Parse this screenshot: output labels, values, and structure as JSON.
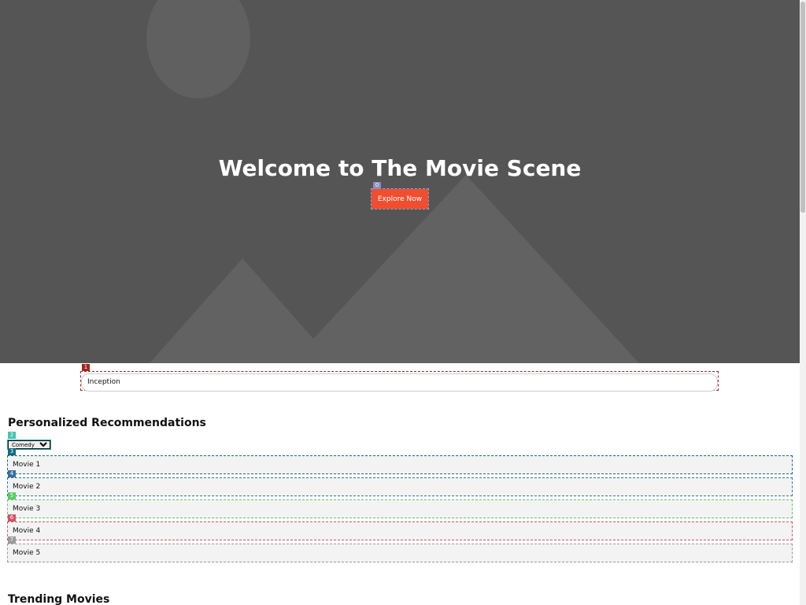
{
  "hero": {
    "title": "Welcome to The Movie Scene",
    "button_label": "Explore Now"
  },
  "search": {
    "value": "Inception"
  },
  "recommendations": {
    "title": "Personalized Recommendations",
    "selected_genre": "Comedy",
    "movies": [
      "Movie 1",
      "Movie 2",
      "Movie 3",
      "Movie 4",
      "Movie 5"
    ]
  },
  "trending": {
    "title": "Trending Movies"
  },
  "markers": [
    "0",
    "1",
    "2",
    "3",
    "4",
    "5",
    "6",
    "7"
  ],
  "colors": {
    "hero_bg": "#555555",
    "accent": "#f04e30",
    "marker_colors": [
      "#8a8fc0",
      "#a0281e",
      "#44c4b0",
      "#126a80",
      "#3a6e9e",
      "#57cc62",
      "#d45068",
      "#9a9a9a"
    ]
  }
}
